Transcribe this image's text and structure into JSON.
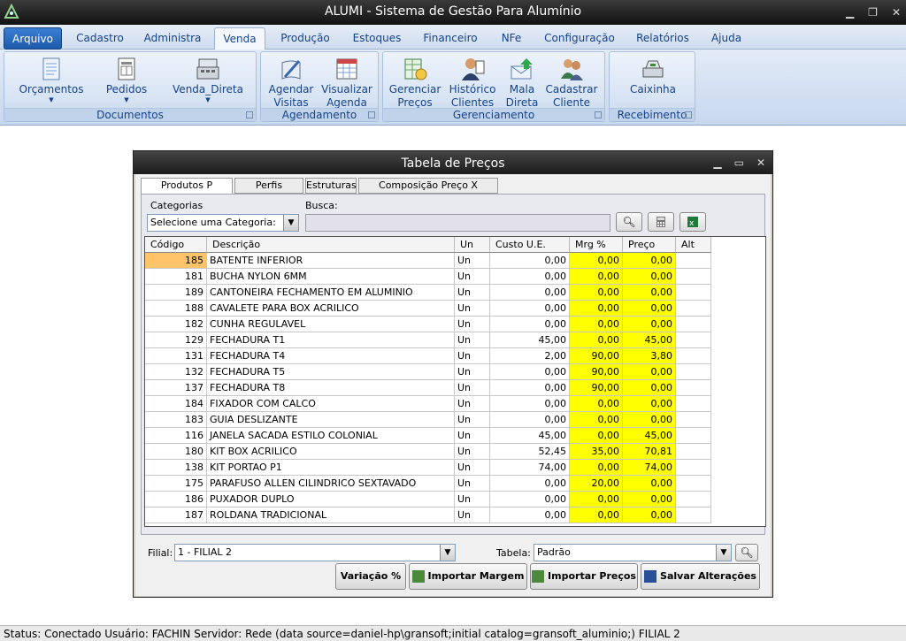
{
  "app": {
    "title": "ALUMI - Sistema de Gestão Para Alumínio"
  },
  "menu": {
    "items": [
      "Arquivo",
      "Cadastro",
      "Administra",
      "Venda",
      "Produção",
      "Estoques",
      "Financeiro",
      "NFe",
      "Configuração",
      "Relatórios",
      "Ajuda"
    ],
    "active": "Venda"
  },
  "ribbon": {
    "groups": [
      {
        "label": "Documentos",
        "buttons": [
          {
            "label": "Orçamentos",
            "icon": "document-icon"
          },
          {
            "label": "Pedidos",
            "icon": "order-sheet-icon"
          },
          {
            "label": "Venda_Direta",
            "icon": "cash-register-icon"
          }
        ]
      },
      {
        "label": "Agendamento",
        "buttons": [
          {
            "label": "Agendar Visitas",
            "icon": "pen-book-icon"
          },
          {
            "label": "Visualizar Agenda",
            "icon": "calendar-icon"
          }
        ]
      },
      {
        "label": "Gerenciamento",
        "buttons": [
          {
            "label": "Gerenciar Preços",
            "icon": "price-sheet-icon"
          },
          {
            "label": "Histórico Clientes",
            "icon": "client-history-icon"
          },
          {
            "label": "Mala Direta",
            "icon": "mail-icon"
          },
          {
            "label": "Cadastrar Cliente",
            "icon": "add-client-icon"
          }
        ]
      },
      {
        "label": "Recebimento",
        "buttons": [
          {
            "label": "Caixinha",
            "icon": "cash-box-icon"
          }
        ]
      }
    ]
  },
  "dialog": {
    "title": "Tabela de Preços",
    "tabs": [
      "Produtos P Revenda",
      "Perfis Aluminio",
      "Estruturas",
      "Composição Preço X Estruturas"
    ],
    "filters": {
      "categorias_label": "Categorias",
      "categorias_value": "Selecione uma Categoria:",
      "busca_label": "Busca:",
      "busca_value": ""
    },
    "grid": {
      "columns": [
        "Código",
        "Descrição",
        "Un",
        "Custo U.E.",
        "Mrg %",
        "Preço",
        "Alt"
      ],
      "rows": [
        [
          "185",
          "BATENTE INFERIOR",
          "Un",
          "0,00",
          "0,00",
          "0,00"
        ],
        [
          "181",
          "BUCHA NYLON 6MM",
          "Un",
          "0,00",
          "0,00",
          "0,00"
        ],
        [
          "189",
          "CANTONEIRA FECHAMENTO EM ALUMINIO",
          "Un",
          "0,00",
          "0,00",
          "0,00"
        ],
        [
          "188",
          "CAVALETE PARA BOX ACRILICO",
          "Un",
          "0,00",
          "0,00",
          "0,00"
        ],
        [
          "182",
          "CUNHA REGULAVEL",
          "Un",
          "0,00",
          "0,00",
          "0,00"
        ],
        [
          "129",
          "FECHADURA T1",
          "Un",
          "45,00",
          "0,00",
          "45,00"
        ],
        [
          "131",
          "FECHADURA T4",
          "Un",
          "2,00",
          "90,00",
          "3,80"
        ],
        [
          "132",
          "FECHADURA T5",
          "Un",
          "0,00",
          "90,00",
          "0,00"
        ],
        [
          "137",
          "FECHADURA T8",
          "Un",
          "0,00",
          "90,00",
          "0,00"
        ],
        [
          "184",
          "FIXADOR COM CALCO",
          "Un",
          "0,00",
          "0,00",
          "0,00"
        ],
        [
          "183",
          "GUIA DESLIZANTE",
          "Un",
          "0,00",
          "0,00",
          "0,00"
        ],
        [
          "116",
          "JANELA SACADA ESTILO COLONIAL",
          "Un",
          "45,00",
          "0,00",
          "45,00"
        ],
        [
          "180",
          "KIT BOX ACRILICO",
          "Un",
          "52,45",
          "35,00",
          "70,81"
        ],
        [
          "138",
          "KIT PORTAO P1",
          "Un",
          "74,00",
          "0,00",
          "74,00"
        ],
        [
          "175",
          "PARAFUSO ALLEN CILINDRICO SEXTAVADO",
          "Un",
          "0,00",
          "20,00",
          "0,00"
        ],
        [
          "186",
          "PUXADOR DUPLO",
          "Un",
          "0,00",
          "0,00",
          "0,00"
        ],
        [
          "187",
          "ROLDANA TRADICIONAL",
          "Un",
          "0,00",
          "0,00",
          "0,00"
        ]
      ]
    },
    "bottom": {
      "filial_label": "Filial:",
      "filial_value": "1 - FILIAL 2",
      "tabela_label": "Tabela:",
      "tabela_value": "Padrão",
      "buttons": [
        "Variação %",
        "Importar Margem",
        "Importar Preços",
        "Salvar Alterações"
      ]
    }
  },
  "status": {
    "text": "Status: Conectado   Usuário: FACHIN  Servidor: Rede (data source=daniel-hp\\gransoft;initial catalog=gransoft_aluminio;)  FILIAL 2"
  },
  "colors": {
    "highlight": "#ffff00",
    "selected_cell": "#ffc46a",
    "ribbon_text": "#15428b"
  }
}
